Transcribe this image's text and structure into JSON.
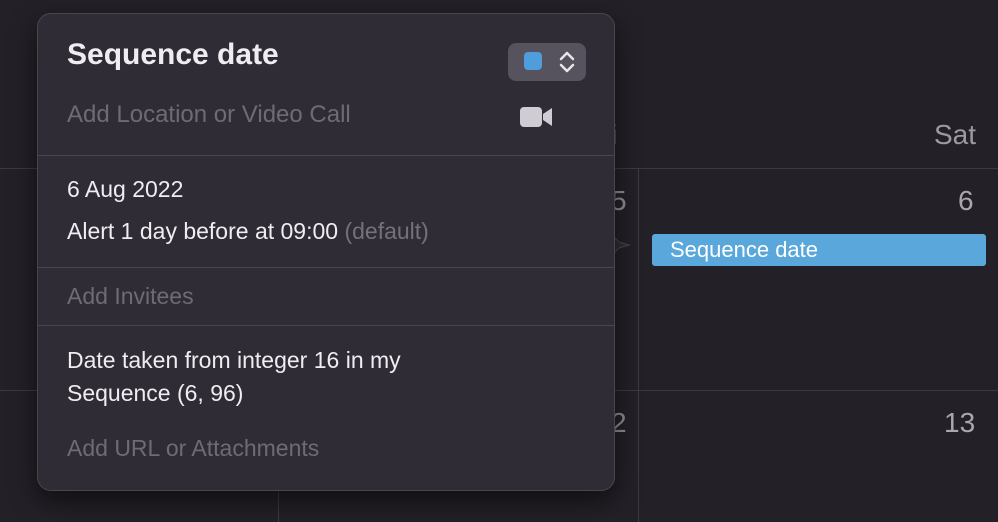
{
  "calendar": {
    "header_partial": "i",
    "header_saturday": "Sat",
    "day_numbers": [
      "6",
      "13"
    ],
    "event_chip": "Sequence date",
    "hidden_fragments": [
      "5",
      "2"
    ]
  },
  "popover": {
    "title": "Sequence date",
    "calendar_color": "#4f9ddb",
    "location_placeholder": "Add Location or Video Call",
    "video_icon": "video-camera-icon",
    "date": "6 Aug 2022",
    "alert": "Alert 1 day before at 09:00",
    "alert_default": "(default)",
    "invitees_placeholder": "Add Invitees",
    "notes": "Date taken from integer 16 in my Sequence (6, 96)",
    "url_placeholder": "Add URL or Attachments"
  }
}
